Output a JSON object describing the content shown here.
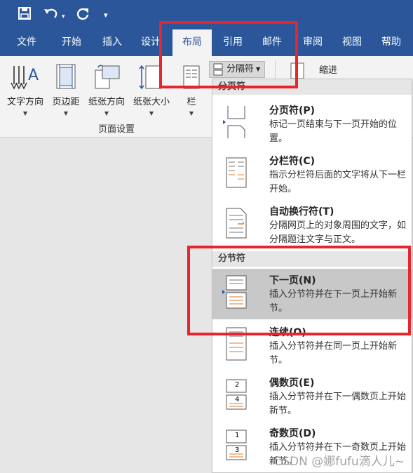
{
  "quick_access": {
    "save_icon": "save-icon",
    "undo_icon": "undo-icon",
    "redo_icon": "redo-icon",
    "customize_icon": "customize-icon"
  },
  "tabs": [
    "文件",
    "开始",
    "插入",
    "设计",
    "布局",
    "引用",
    "邮件",
    "审阅",
    "视图",
    "帮助"
  ],
  "active_tab": "布局",
  "ribbon": {
    "buttons": [
      "文字方向",
      "页边距",
      "纸张方向",
      "纸张大小",
      "栏"
    ],
    "group_label": "页面设置",
    "breaks_label": "分隔符",
    "indent_label": "缩进"
  },
  "menu": {
    "page_breaks_header": "分页符",
    "section_breaks_header": "分节符",
    "items": [
      {
        "title": "分页符(P)",
        "desc": "标记一页结束与下一页开始的位置。"
      },
      {
        "title": "分栏符(C)",
        "desc": "指示分栏符后面的文字将从下一栏开始。"
      },
      {
        "title": "自动换行符(T)",
        "desc": "分隔网页上的对象周围的文字，如分隔题注文字与正文。"
      },
      {
        "title": "下一页(N)",
        "desc": "插入分节符并在下一页上开始新节。"
      },
      {
        "title": "连续(O)",
        "desc": "插入分节符并在同一页上开始新节。"
      },
      {
        "title": "偶数页(E)",
        "desc": "插入分节符并在下一偶数页上开始新节。"
      },
      {
        "title": "奇数页(D)",
        "desc": "插入分节符并在下一奇数页上开始新节。"
      }
    ],
    "icon_numbers": {
      "even": [
        "2",
        "4"
      ],
      "odd": [
        "1",
        "3"
      ]
    }
  },
  "watermark": "CSDN @娜fufu滴人儿~",
  "colors": {
    "title_bar": "#2b579a",
    "highlight": "#c8c8c8",
    "annotation_red": "#e8252c",
    "accent_orange": "#e07b28"
  }
}
